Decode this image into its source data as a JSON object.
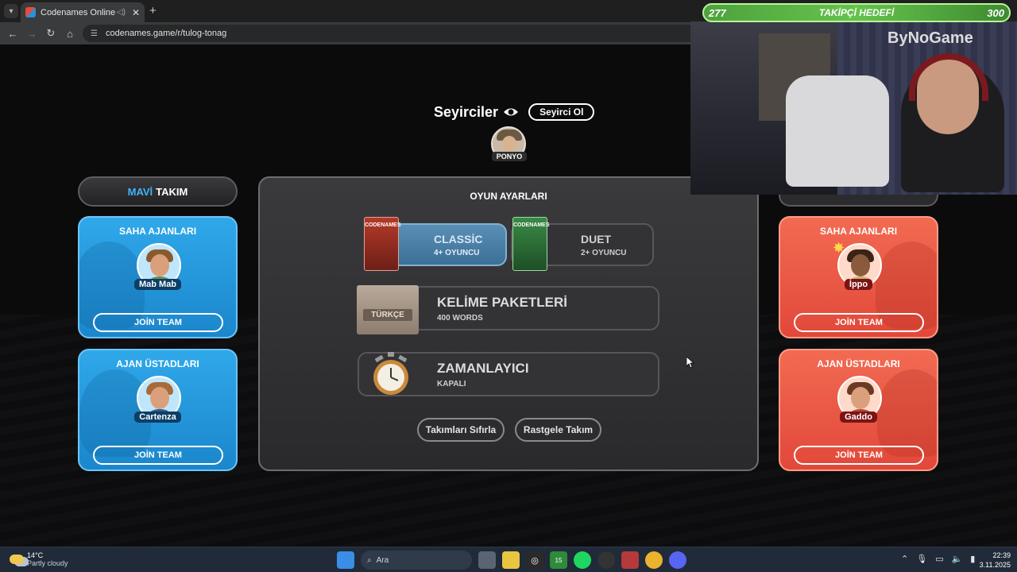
{
  "browser": {
    "tab_title": "Codenames Online",
    "url": "codenames.game/r/tulog-tonag"
  },
  "spectators": {
    "title": "Seyirciler",
    "button_label": "Seyirci Ol",
    "players": [
      {
        "name": "PONYO"
      }
    ]
  },
  "blue_team": {
    "header_colored": "MAVİ",
    "header_rest": "TAKIM",
    "operatives": {
      "title": "SAHA AJANLARI",
      "player": "Mab Mab",
      "join_label": "JOİN TEAM"
    },
    "spymasters": {
      "title": "AJAN ÜSTADLARI",
      "player": "Cartenza",
      "join_label": "JOİN TEAM"
    }
  },
  "red_team": {
    "operatives": {
      "title": "SAHA AJANLARI",
      "player": "İppo",
      "join_label": "JOİN TEAM"
    },
    "spymasters": {
      "title": "AJAN ÜSTADLARI",
      "player": "Gaddo",
      "join_label": "JOİN TEAM"
    }
  },
  "settings": {
    "title": "OYUN AYARLARI",
    "modes": [
      {
        "name": "CLASSİC",
        "sub": "4+ OYUNCU",
        "box_label": "CODENAMES",
        "selected": true
      },
      {
        "name": "DUET",
        "sub": "2+ OYUNCU",
        "box_label": "CODENAMES",
        "selected": false
      }
    ],
    "word_packs": {
      "title": "KELİME PAKETLERİ",
      "sub": "400 WORDS",
      "crate_label": "TÜRKÇE"
    },
    "timer": {
      "title": "ZAMANLAYICI",
      "sub": "KAPALI"
    },
    "reset_label": "Takımları Sıfırla",
    "random_label": "Rastgele Takım"
  },
  "stream": {
    "goal_current": "277",
    "goal_label": "TAKİPÇİ HEDEFİ",
    "goal_target": "300",
    "channel_logo": "ByNoGame"
  },
  "taskbar": {
    "weather_temp": "14°C",
    "weather_desc": "Partly cloudy",
    "search_placeholder": "Ara",
    "badge_count": "15",
    "time": "22:39",
    "date": "3.11.2025"
  },
  "colors": {
    "blue_card": "#2fa8ea",
    "red_card": "#f26a52",
    "panel": "#333336",
    "goal_bar": "#66c24d"
  }
}
